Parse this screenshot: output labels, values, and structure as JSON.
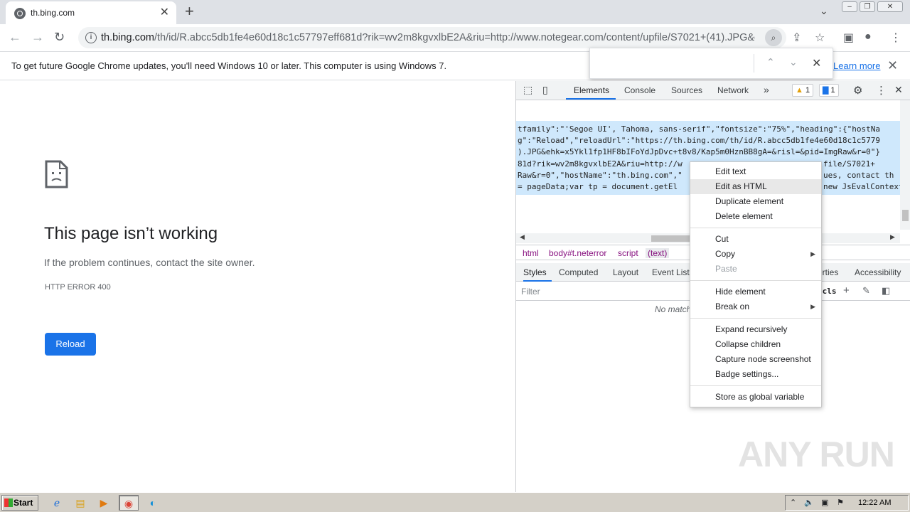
{
  "tab": {
    "title": "th.bing.com",
    "close": "✕"
  },
  "toolbar": {
    "url_host": "th.bing.com",
    "url_rest": "/th/id/R.abcc5db1fe4e60d18c1c57797eff681d?rik=wv2m8kgvxlbE2A&riu=http://www.notegear.com/content/upfile/S7021+(41).JPG&e..."
  },
  "infobar": {
    "message": "To get future Google Chrome updates, you'll need Windows 10 or later. This computer is using Windows 7.",
    "learn_more": "Learn more"
  },
  "error_page": {
    "title": "This page isn’t working",
    "subtitle": "If the problem continues, contact the site owner.",
    "code": "HTTP ERROR 400",
    "reload": "Reload"
  },
  "devtools": {
    "tabs": [
      "Elements",
      "Console",
      "Sources",
      "Network"
    ],
    "more": "»",
    "warnings": "1",
    "messages": "1",
    "code_lines": [
      "tfamily\":\"'Segoe UI', Tahoma, sans-serif\",\"fontsize\":\"75%\",\"heading\":{\"hostNa",
      "g\":\"Reload\",\"reloadUrl\":\"https://th.bing.com/th/id/R.abcc5db1fe4e60d18c1c5779",
      ").JPG&ehk=x5Ykl1fp1HF8bIFoYdJpDvc+t8v8/Kap5m0HznBB8gA=&risl=&pid=ImgRaw&r=0\"}",
      "81d?rik=wv2m8kgvxlbE2A&riu=http://w",
      "Raw&r=0\",\"hostName\":\"th.bing.com\",\"",
      " = pageData;var tp = document.getEl"
    ],
    "code_lines_right": [
      "file/S7021+",
      "ues, contact th",
      "new JsEvalContext"
    ],
    "breadcrumbs": [
      "html",
      "body#t.neterror",
      "script",
      "(text)"
    ],
    "subtabs": [
      "Styles",
      "Computed",
      "Layout",
      "Event Liste",
      "erties",
      "Accessibility"
    ],
    "filter_placeholder": "Filter",
    "cls": ":cls",
    "no_match": "No match"
  },
  "context_menu": {
    "items": [
      "Edit text",
      "Edit as HTML",
      "Duplicate element",
      "Delete element",
      "Cut",
      "Copy",
      "Paste",
      "Hide element",
      "Break on",
      "Expand recursively",
      "Collapse children",
      "Capture node screenshot",
      "Badge settings...",
      "Store as global variable"
    ]
  },
  "watermark": "ANY RUN",
  "taskbar": {
    "start": "Start",
    "clock": "12:22 AM"
  }
}
